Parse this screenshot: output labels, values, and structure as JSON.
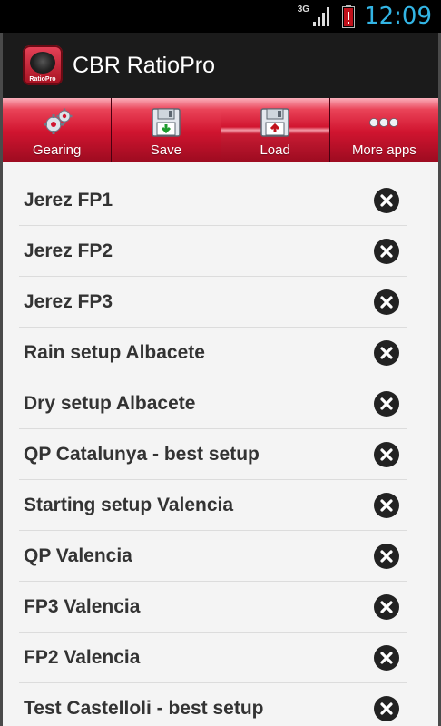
{
  "status_bar": {
    "network": "3G",
    "time": "12:09"
  },
  "app": {
    "title": "CBR RatioPro",
    "logo_text": "RatioPro",
    "logo_brand": "CBR"
  },
  "toolbar": [
    {
      "label": "Gearing",
      "icon": "gears-icon"
    },
    {
      "label": "Save",
      "icon": "save-icon"
    },
    {
      "label": "Load",
      "icon": "load-icon",
      "selected": true
    },
    {
      "label": "More apps",
      "icon": "more-icon"
    }
  ],
  "setups": [
    {
      "name": "Jerez FP1"
    },
    {
      "name": "Jerez FP2"
    },
    {
      "name": "Jerez FP3"
    },
    {
      "name": "Rain setup Albacete"
    },
    {
      "name": "Dry setup Albacete"
    },
    {
      "name": "QP Catalunya - best setup"
    },
    {
      "name": "Starting setup Valencia"
    },
    {
      "name": "QP Valencia"
    },
    {
      "name": "FP3 Valencia"
    },
    {
      "name": "FP2 Valencia"
    },
    {
      "name": "Test Castelloli - best setup"
    }
  ],
  "colors": {
    "accent": "#d11530",
    "clock": "#33b5e5",
    "list_bg": "#f4f4f4",
    "text": "#333333"
  }
}
